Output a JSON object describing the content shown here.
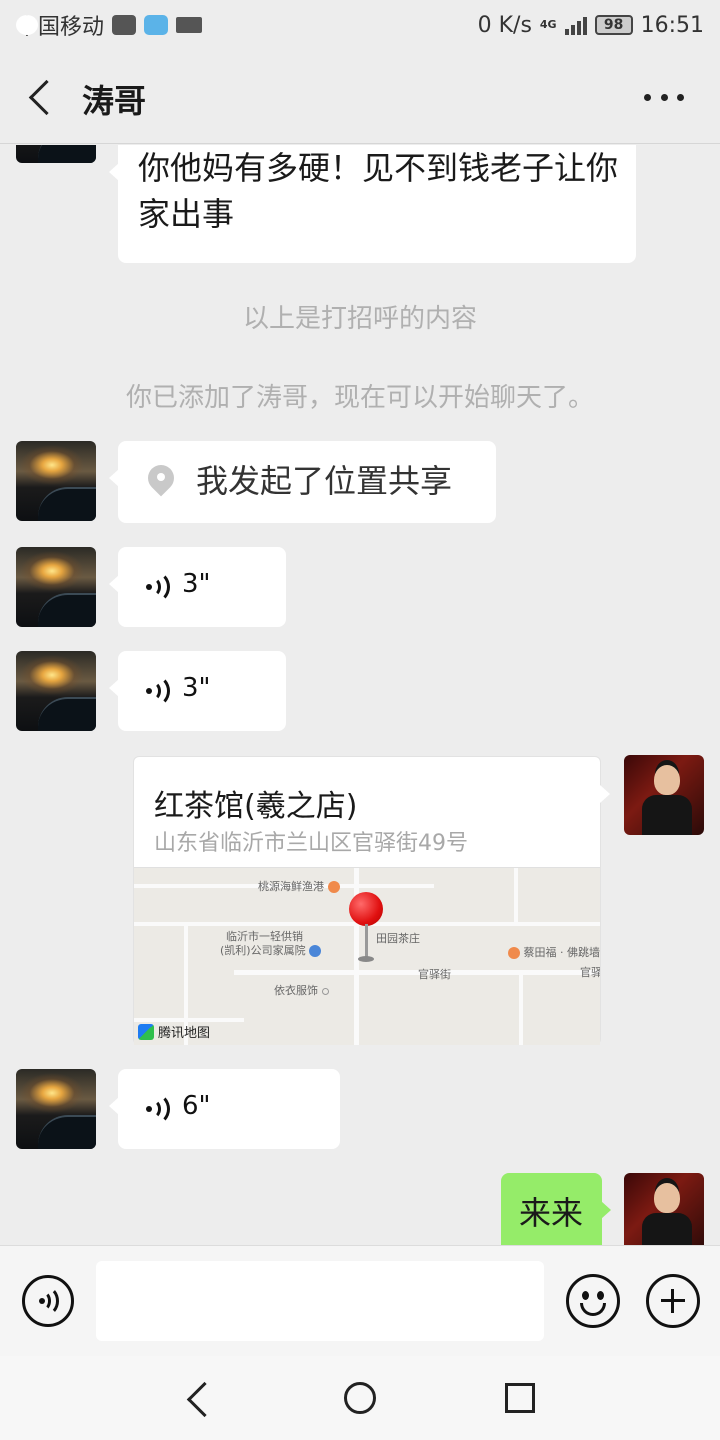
{
  "status_bar": {
    "carrier": "中国移动",
    "speed": "0 K/s",
    "network": "4G",
    "battery": "98",
    "time": "16:51"
  },
  "header": {
    "title": "涛哥"
  },
  "messages": {
    "m1_text": "你他妈有多硬！见不到钱老子让你家出事",
    "system1": "以上是打招呼的内容",
    "system2": "你已添加了涛哥，现在可以开始聊天了。",
    "location_share": "我发起了位置共享",
    "voice1": "3\"",
    "voice2": "3\"",
    "location_card": {
      "name": "红茶馆(羲之店)",
      "address": "山东省临沂市兰山区官驿街49号",
      "map_labels": {
        "poi1": "桃源海鲜渔港",
        "poi2": "临沂市一轻供销",
        "poi2b": "(凯利)公司家属院",
        "poi3": "田园茶庄",
        "poi4": "蔡田福 · 佛跳墙",
        "street": "官驿街",
        "street2": "官驿",
        "poi5": "依衣服饰",
        "brand": "腾讯地图"
      }
    },
    "voice3": "6\"",
    "out_text": "来来"
  },
  "input_bar": {
    "value": ""
  }
}
